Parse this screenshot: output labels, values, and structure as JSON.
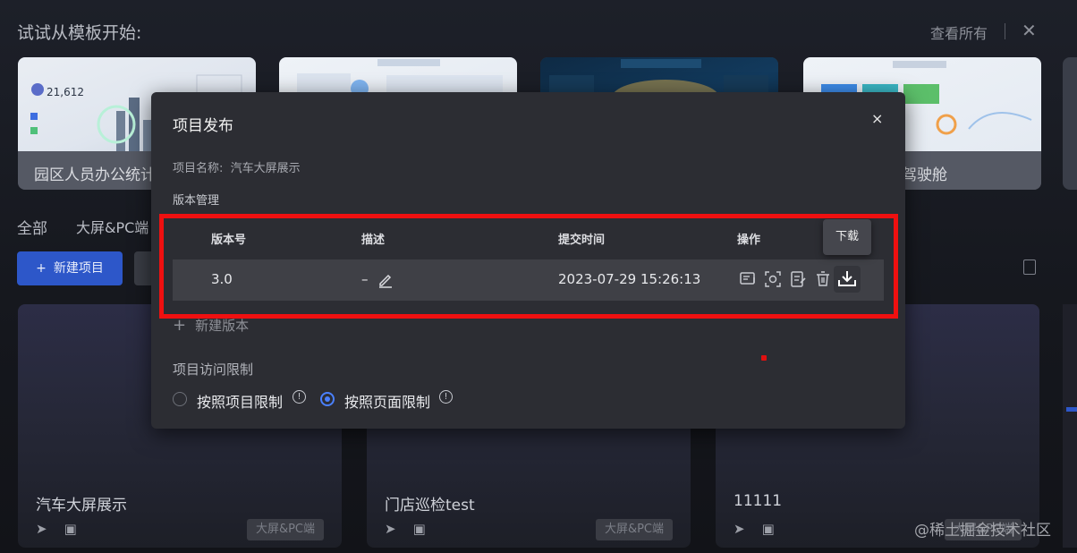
{
  "header": {
    "section_title": "试试从模板开始:",
    "view_all": "查看所有",
    "close_glyph": "✕"
  },
  "templates": [
    {
      "title": "园区人员办公统计",
      "stat_label": "21,612"
    },
    {
      "title": ""
    },
    {
      "title": ""
    },
    {
      "title": "驾驶舱"
    }
  ],
  "filters": {
    "all": "全部",
    "screen_pc": "大屏&PC端"
  },
  "toolbar": {
    "new_project": "新建项目",
    "new_project_glyph": "+"
  },
  "projects": [
    {
      "name": "汽车大屏展示",
      "tag": "大屏&PC端"
    },
    {
      "name": "门店巡检test",
      "tag": "大屏&PC端"
    },
    {
      "name": "11111",
      "tag": "大屏&PC端"
    }
  ],
  "dialog": {
    "title": "项目发布",
    "close_glyph": "×",
    "project_name_label": "项目名称:",
    "project_name_value": "汽车大屏展示",
    "version_mgmt_label": "版本管理",
    "table": {
      "headers": [
        "版本号",
        "描述",
        "提交时间",
        "操作"
      ],
      "rows": [
        {
          "version": "3.0",
          "description": "–",
          "submitted": "2023-07-29 15:26:13"
        }
      ]
    },
    "tooltip_download": "下载",
    "new_version_label": "新建版本",
    "new_version_glyph": "+",
    "access_label": "项目访问限制",
    "access_options": [
      {
        "label": "按照项目限制",
        "selected": false
      },
      {
        "label": "按照页面限制",
        "selected": true
      }
    ],
    "info_glyph": "!"
  },
  "watermark": "@稀土掘金技术社区",
  "colors": {
    "primary": "#2d57c9",
    "radio_selected": "#4a80ff",
    "highlight": "#ef1010"
  }
}
